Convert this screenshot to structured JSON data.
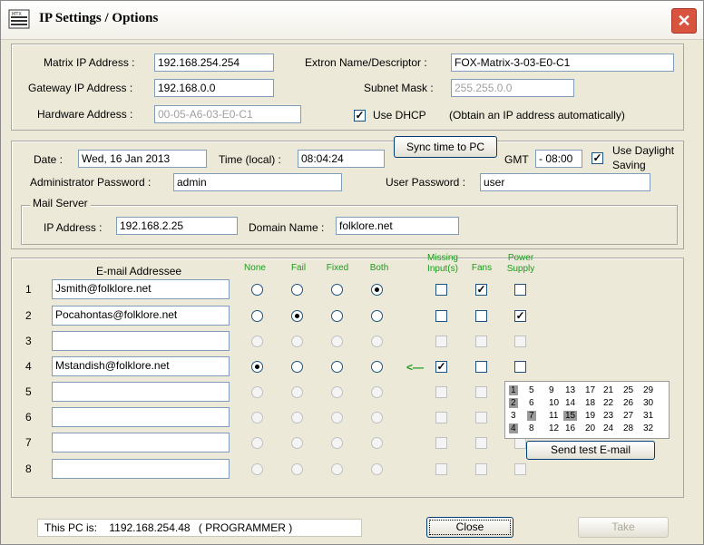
{
  "window": {
    "title": "IP Settings / Options",
    "app_icon": "matrix-app-icon",
    "close_icon": "close-x-icon"
  },
  "network": {
    "matrix_ip_label": "Matrix IP Address :",
    "matrix_ip": "192.168.254.254",
    "gateway_label": "Gateway IP Address :",
    "gateway_ip": "192.168.0.0",
    "hardware_label": "Hardware Address :",
    "hardware_address": "00-05-A6-03-E0-C1",
    "name_label": "Extron Name/Descriptor :",
    "name": "FOX-Matrix-3-03-E0-C1",
    "subnet_label": "Subnet Mask :",
    "subnet": "255.255.0.0",
    "dhcp_label": "Use DHCP",
    "dhcp_note": "(Obtain an IP address automatically)",
    "dhcp_checked": true
  },
  "time": {
    "date_label": "Date :",
    "date": "Wed, 16 Jan 2013",
    "time_label": "Time (local) :",
    "time": "08:04:24",
    "sync_button": "Sync time to PC",
    "gmt_label": "GMT",
    "gmt": "- 08:00",
    "daylight_label_1": "Use Daylight",
    "daylight_label_2": "Saving",
    "daylight_checked": true,
    "admin_label": "Administrator Password :",
    "admin_password": "admin",
    "user_label": "User Password :",
    "user_password": "user",
    "mail_server_label": "Mail Server",
    "mail_ip_label": "IP Address :",
    "mail_ip": "192.168.2.25",
    "domain_label": "Domain Name :",
    "domain": "folklore.net"
  },
  "email": {
    "header": "E-mail Addressee",
    "columns": {
      "none": "None",
      "fail": "Fail",
      "fixed": "Fixed",
      "both": "Both",
      "missing_1": "Missing",
      "missing_2": "Input(s)",
      "fans": "Fans",
      "power_1": "Power",
      "power_2": "Supply"
    },
    "arrow": "<—",
    "rows": [
      {
        "num": "1",
        "address": "Jsmith@folklore.net",
        "radio": "both",
        "missing": false,
        "fans": true,
        "power": false,
        "enabled": true
      },
      {
        "num": "2",
        "address": "Pocahontas@folklore.net",
        "radio": "fail",
        "missing": false,
        "fans": false,
        "power": true,
        "enabled": true
      },
      {
        "num": "3",
        "address": "",
        "radio": "",
        "missing": false,
        "fans": false,
        "power": false,
        "enabled": false
      },
      {
        "num": "4",
        "address": "Mstandish@folklore.net",
        "radio": "none",
        "missing": true,
        "fans": false,
        "power": false,
        "enabled": true
      },
      {
        "num": "5",
        "address": "",
        "radio": "",
        "missing": false,
        "fans": false,
        "power": false,
        "enabled": false
      },
      {
        "num": "6",
        "address": "",
        "radio": "",
        "missing": false,
        "fans": false,
        "power": false,
        "enabled": false
      },
      {
        "num": "7",
        "address": "",
        "radio": "",
        "missing": false,
        "fans": false,
        "power": false,
        "enabled": false
      },
      {
        "num": "8",
        "address": "",
        "radio": "",
        "missing": false,
        "fans": false,
        "power": false,
        "enabled": false
      }
    ],
    "send_test_button": "Send test E-mail",
    "grid": [
      [
        "1",
        "5",
        "9",
        "13",
        "17",
        "21",
        "25",
        "29"
      ],
      [
        "2",
        "6",
        "10",
        "14",
        "18",
        "22",
        "26",
        "30"
      ],
      [
        "3",
        "7",
        "11",
        "15",
        "19",
        "23",
        "27",
        "31"
      ],
      [
        "4",
        "8",
        "12",
        "16",
        "20",
        "24",
        "28",
        "32"
      ]
    ],
    "grid_highlighted": [
      "1",
      "2",
      "4",
      "7",
      "15"
    ]
  },
  "footer": {
    "pc_label": "This PC is:",
    "pc_value": "1192.168.254.48",
    "pc_role": "( PROGRAMMER )",
    "close_button": "Close",
    "take_button": "Take"
  }
}
